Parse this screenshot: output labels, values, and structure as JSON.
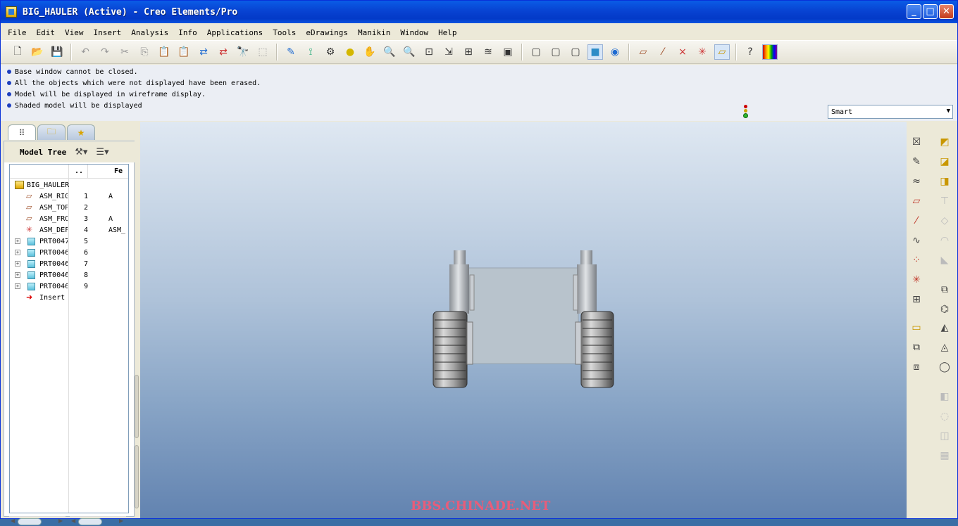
{
  "window": {
    "title": "BIG_HAULER (Active) - Creo Elements/Pro"
  },
  "menu": [
    "File",
    "Edit",
    "View",
    "Insert",
    "Analysis",
    "Info",
    "Applications",
    "Tools",
    "eDrawings",
    "Manikin",
    "Window",
    "Help"
  ],
  "messages": [
    "Base window cannot be closed.",
    "All the objects which were not displayed have been erased.",
    "Model will be displayed in wireframe display.",
    "Shaded model will be displayed"
  ],
  "filter": {
    "value": "Smart"
  },
  "model_tree": {
    "title": "Model Tree",
    "col_dots": "..",
    "col_feat": "Fe",
    "root": "BIG_HAULER",
    "rows": [
      {
        "name": "ASM_RIG",
        "num": "1",
        "feat": "A"
      },
      {
        "name": "ASM_TOP",
        "num": "2",
        "feat": ""
      },
      {
        "name": "ASM_FRO",
        "num": "3",
        "feat": "A"
      },
      {
        "name": "ASM_DEF",
        "num": "4",
        "feat": "ASM_"
      },
      {
        "name": "PRT0047",
        "num": "5",
        "feat": ""
      },
      {
        "name": "PRT0046",
        "num": "6",
        "feat": ""
      },
      {
        "name": "PRT0046",
        "num": "7",
        "feat": ""
      },
      {
        "name": "PRT0046",
        "num": "8",
        "feat": ""
      },
      {
        "name": "PRT0046",
        "num": "9",
        "feat": ""
      }
    ],
    "insert": "Insert"
  },
  "watermark": "BBS.CHINADE.NET",
  "colors": {
    "title_blue": "#0843d2",
    "viewport_top": "#dfe8f2",
    "viewport_bottom": "#6283b0"
  }
}
